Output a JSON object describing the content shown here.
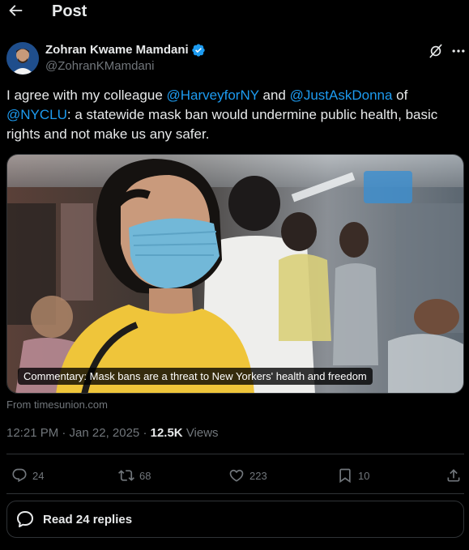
{
  "header": {
    "title": "Post"
  },
  "author": {
    "name": "Zohran Kwame Mamdani",
    "handle": "@ZohranKMamdani"
  },
  "post": {
    "segments": [
      "I agree with my colleague ",
      "@HarveyforNY",
      " and ",
      "@JustAskDonna",
      " of ",
      "@NYCLU",
      ": a statewide mask ban would undermine public health, basic rights and not make us any safer."
    ]
  },
  "card": {
    "caption": "Commentary: Mask bans are a threat to New Yorkers' health and freedom",
    "source": "From timesunion.com"
  },
  "meta": {
    "time": "12:21 PM · Jan 22, 2025 · ",
    "views_count": "12.5K",
    "views_label": "Views"
  },
  "actions": {
    "replies": "24",
    "reposts": "68",
    "likes": "223",
    "bookmarks": "10"
  },
  "read_replies": {
    "label": "Read 24 replies"
  },
  "colors": {
    "accent": "#1d9bf0",
    "background": "#000000",
    "muted": "#71767b",
    "border": "#2f3336"
  }
}
